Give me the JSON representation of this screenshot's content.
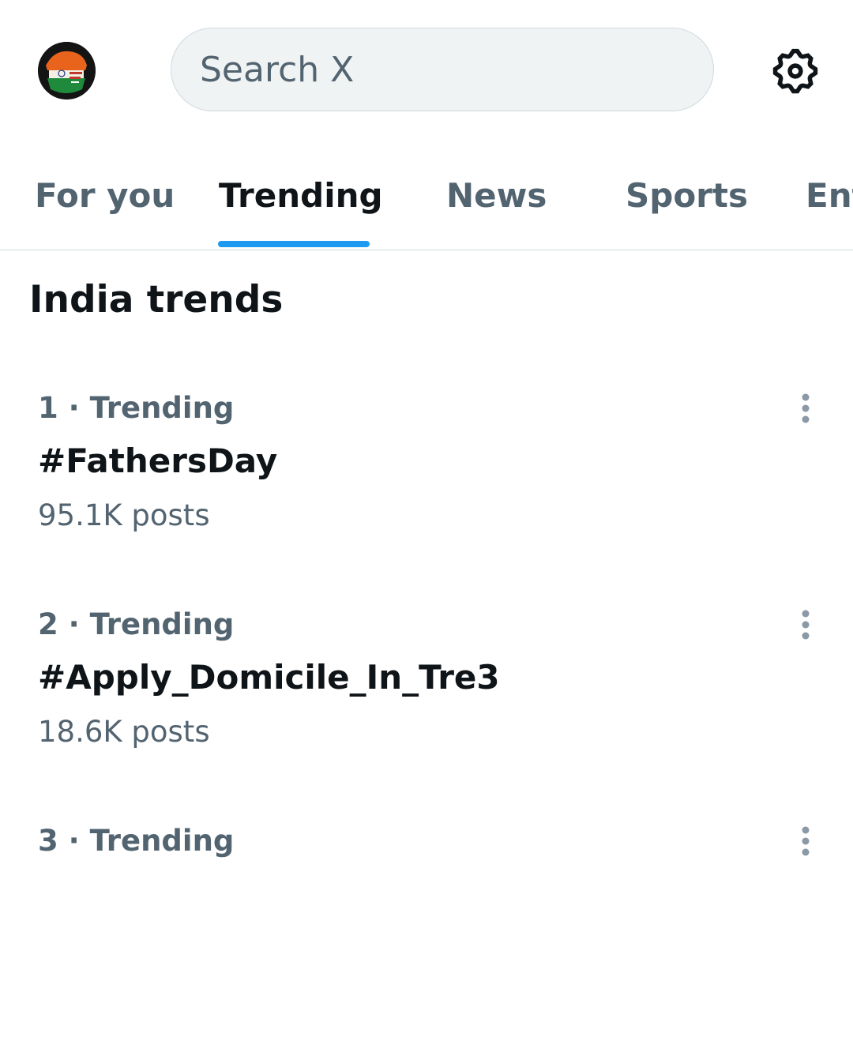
{
  "search": {
    "placeholder": "Search X"
  },
  "icons": {
    "settings": "gear-icon",
    "more": "more-vertical-icon"
  },
  "colors": {
    "accent": "#1d9bf0",
    "text_primary": "#0f1419",
    "text_secondary": "#536471",
    "search_bg": "#eff3f4"
  },
  "tabs": [
    {
      "label": "For you",
      "active": false
    },
    {
      "label": "Trending",
      "active": true
    },
    {
      "label": "News",
      "active": false
    },
    {
      "label": "Sports",
      "active": false
    },
    {
      "label": "Ent",
      "active": false
    }
  ],
  "section": {
    "title": "India trends"
  },
  "trends": [
    {
      "meta": "1 · Trending",
      "name": "#FathersDay",
      "count": "95.1K posts"
    },
    {
      "meta": "2 · Trending",
      "name": "#Apply_Domicile_In_Tre3",
      "count": "18.6K posts"
    },
    {
      "meta": "3 · Trending",
      "name": "",
      "count": ""
    }
  ]
}
